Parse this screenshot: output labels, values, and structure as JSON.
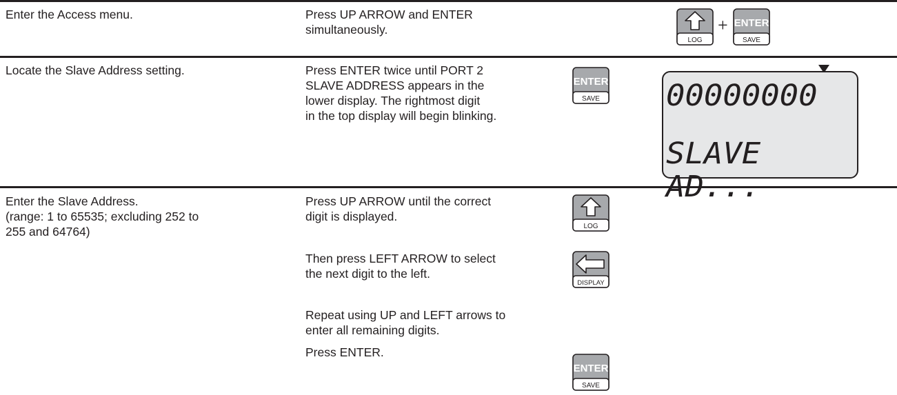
{
  "rows": [
    {
      "step": [
        "Enter the Access menu."
      ],
      "action": [
        "Press UP ARROW and ENTER",
        "simultaneously."
      ],
      "keys": {
        "up_label": "LOG",
        "plus": "+",
        "enter_top": "ENTER",
        "enter_bottom": "SAVE"
      }
    },
    {
      "step": [
        "Locate the Slave Address setting."
      ],
      "action": [
        "Press ENTER twice until PORT 2",
        "SLAVE ADDRESS appears in the",
        "lower display. The rightmost digit",
        "in the top display will begin blinking."
      ],
      "keys": {
        "enter_top": "ENTER",
        "enter_bottom": "SAVE"
      },
      "display": {
        "top": "00000000",
        "bottom": "SLAVE AD..."
      }
    },
    {
      "step": [
        "Enter the Slave Address.",
        "(range: 1 to 65535; excluding 252 to",
        "255 and 64764)"
      ],
      "actions": [
        {
          "lines": [
            "Press UP ARROW until the correct",
            "digit is displayed."
          ],
          "key_label": "LOG"
        },
        {
          "lines": [
            "Then press LEFT ARROW to select",
            "the next digit to the left."
          ],
          "key_label": "DISPLAY"
        },
        {
          "lines": [
            "Repeat using UP and LEFT arrows to",
            "enter all remaining digits."
          ]
        },
        {
          "lines": [
            "Press ENTER."
          ],
          "key_top": "ENTER",
          "key_bottom": "SAVE"
        }
      ]
    }
  ],
  "colors": {
    "text": "#231f20",
    "key_fill": "#a7a9ac",
    "lcd_fill": "#e6e7e8",
    "rule": "#231f20"
  }
}
